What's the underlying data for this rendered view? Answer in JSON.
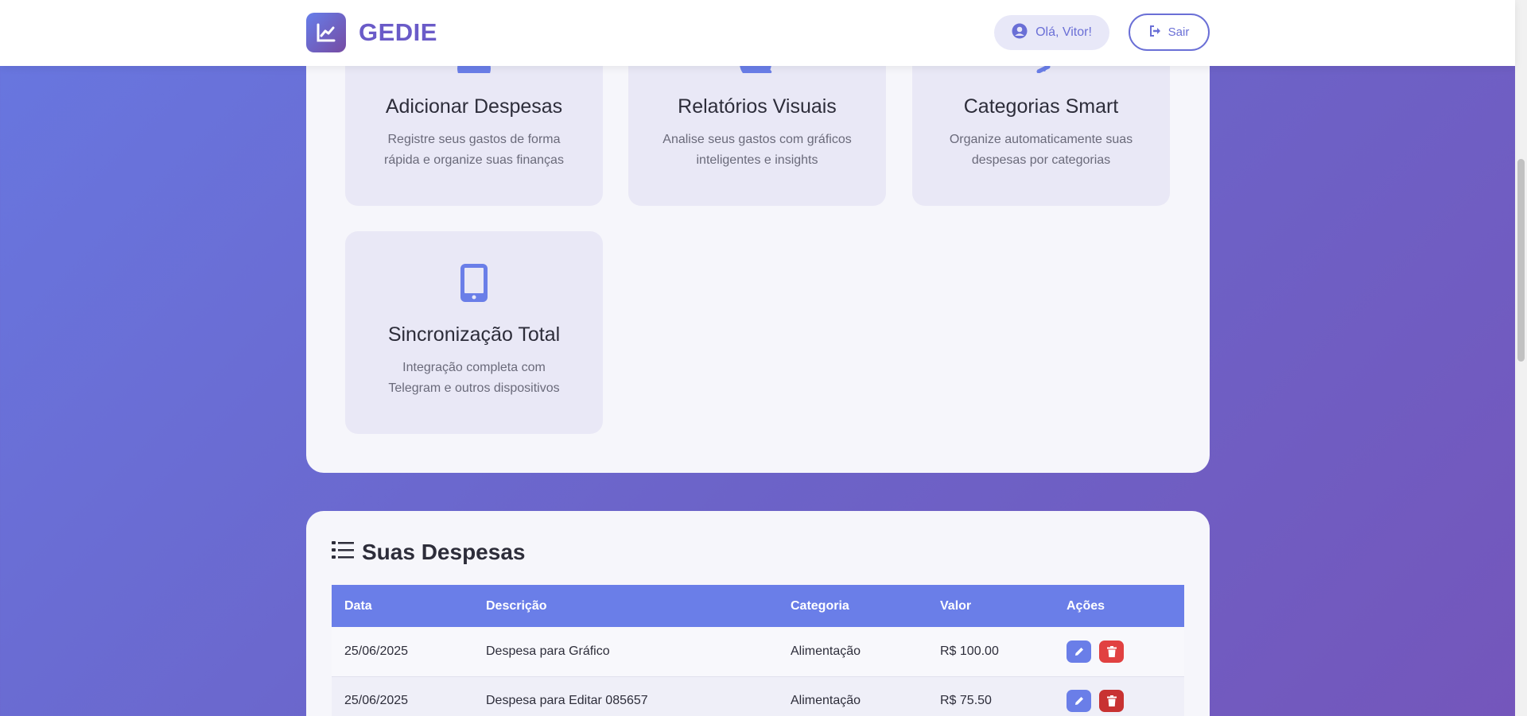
{
  "header": {
    "brand": "GEDIE",
    "greeting": "Olá, Vitor!",
    "logout_label": "Sair"
  },
  "features": [
    {
      "title": "Adicionar Despesas",
      "desc_line1": "Registre seus gastos de forma",
      "desc_line2": "rápida e organize suas finanças",
      "icon": "plus-circle-icon"
    },
    {
      "title": "Relatórios Visuais",
      "desc_line1": "Analise seus gastos com gráficos",
      "desc_line2": "inteligentes e insights",
      "icon": "chart-search-icon"
    },
    {
      "title": "Categorias Smart",
      "desc_line1": "Organize automaticamente suas",
      "desc_line2": "despesas por categorias",
      "icon": "tags-icon"
    },
    {
      "title": "Sincronização Total",
      "desc_line1": "Integração completa com",
      "desc_line2": "Telegram e outros dispositivos",
      "icon": "mobile-icon"
    }
  ],
  "expenses": {
    "title": "Suas Despesas",
    "columns": [
      "Data",
      "Descrição",
      "Categoria",
      "Valor",
      "Ações"
    ],
    "rows": [
      {
        "date": "25/06/2025",
        "description": "Despesa para Gráfico",
        "category": "Alimentação",
        "value": "R$ 100.00"
      },
      {
        "date": "25/06/2025",
        "description": "Despesa para Editar 085657",
        "category": "Alimentação",
        "value": "R$ 75.50"
      }
    ]
  },
  "colors": {
    "accent": "#6a7ee8",
    "brand": "#6a5bc8",
    "danger": "#e14141"
  }
}
